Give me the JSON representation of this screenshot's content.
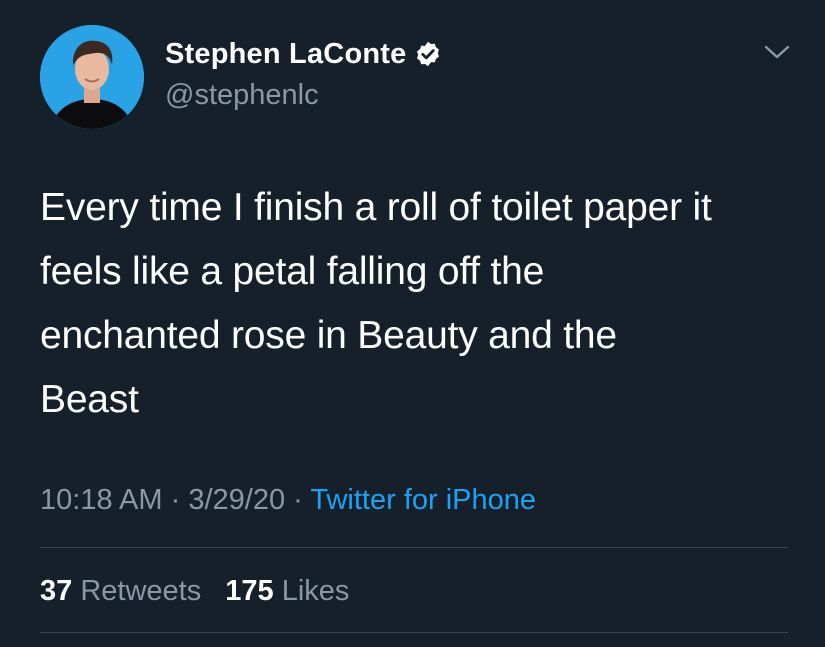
{
  "tweet": {
    "author": {
      "display_name": "Stephen LaConte",
      "handle": "@stephenlc",
      "verified": true,
      "avatar_icon": "profile-photo"
    },
    "text_lines": [
      "Every time I finish a roll of toilet paper it",
      "feels like a petal falling off the",
      "enchanted rose in Beauty and the",
      "Beast"
    ],
    "time": "10:18 AM",
    "date": "3/29/20",
    "separator": "·",
    "source": "Twitter for iPhone",
    "stats": {
      "retweets_count": "37",
      "retweets_label": "Retweets",
      "likes_count": "175",
      "likes_label": "Likes"
    },
    "menu_icon": "chevron-down-icon"
  },
  "colors": {
    "background": "#15202b",
    "text_primary": "#ffffff",
    "text_secondary": "#8899a6",
    "accent": "#1da1f2",
    "divider": "#38444d"
  }
}
